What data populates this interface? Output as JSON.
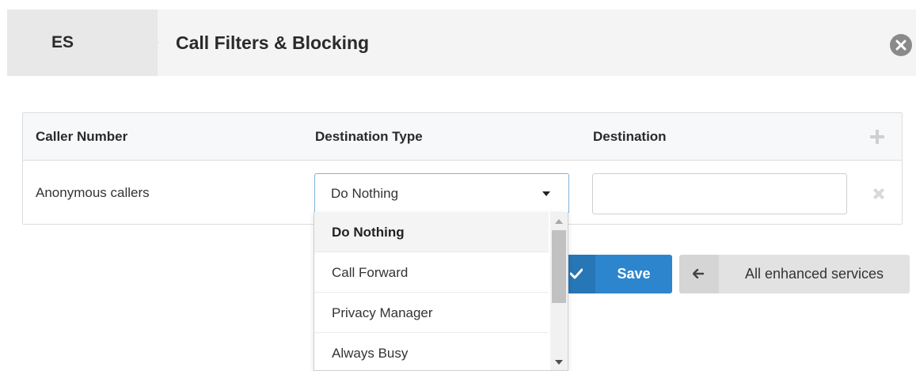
{
  "header": {
    "crumb": "ES",
    "title": "Call Filters & Blocking"
  },
  "table": {
    "columns": [
      "Caller Number",
      "Destination Type",
      "Destination"
    ],
    "rows": [
      {
        "caller_number": "Anonymous callers",
        "destination_type": "Do Nothing",
        "destination": ""
      }
    ]
  },
  "dropdown": {
    "options": [
      "Do Nothing",
      "Call Forward",
      "Privacy Manager",
      "Always Busy"
    ],
    "selected": "Do Nothing"
  },
  "buttons": {
    "save": "Save",
    "back": "All enhanced services"
  },
  "icons": {
    "close": "close-icon",
    "add": "plus-icon",
    "remove": "remove-icon",
    "check": "check-icon",
    "back": "arrow-left-icon",
    "caret": "caret-down-icon"
  },
  "colors": {
    "primary": "#2d86cd",
    "header_bg": "#f4f4f4",
    "secondary_btn": "#e2e2e2"
  }
}
